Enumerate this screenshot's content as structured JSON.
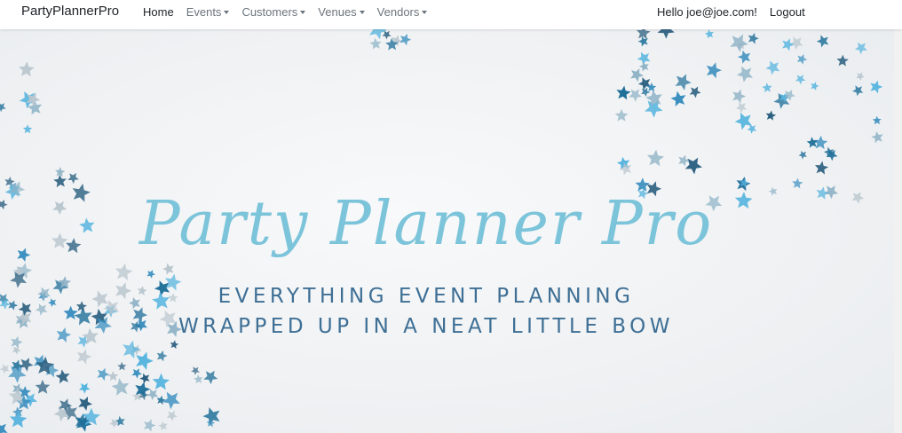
{
  "nav": {
    "brand": "PartyPlannerPro",
    "links": [
      {
        "label": "Home",
        "dropdown": false
      },
      {
        "label": "Events",
        "dropdown": true
      },
      {
        "label": "Customers",
        "dropdown": true
      },
      {
        "label": "Venues",
        "dropdown": true
      },
      {
        "label": "Vendors",
        "dropdown": true
      }
    ],
    "greeting": "Hello joe@joe.com!",
    "logout": "Logout"
  },
  "hero": {
    "title": "Party Planner Pro",
    "tagline_line1": "EVERYTHING EVENT PLANNING",
    "tagline_line2": "WRAPPED UP IN A NEAT LITTLE BOW",
    "colors": {
      "title": "#7cc4da",
      "tagline": "#3e6f95",
      "confetti": [
        "#1f6f99",
        "#3a8fbf",
        "#56b4de",
        "#8fb3c6",
        "#b9c6ce",
        "#2b5f80"
      ]
    }
  }
}
